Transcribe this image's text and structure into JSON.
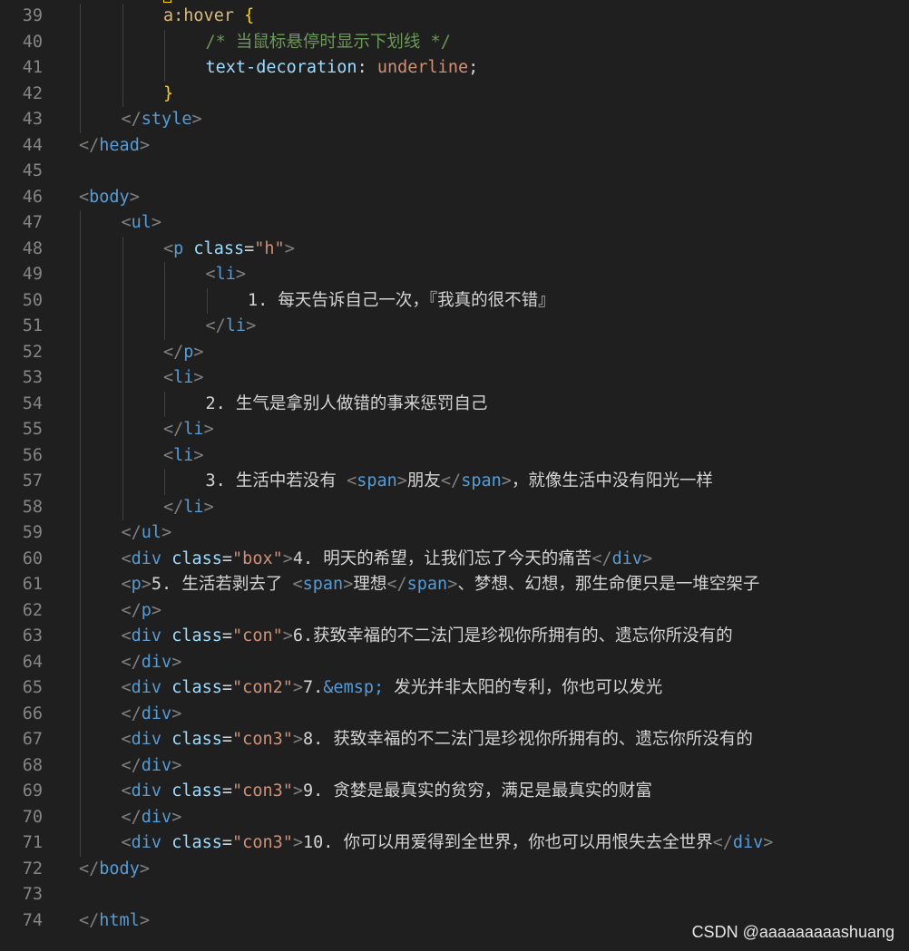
{
  "editor": {
    "lines": [
      {
        "n": "39",
        "indent": 2,
        "tokens": [
          {
            "t": "a:hover ",
            "c": "sel"
          },
          {
            "t": "{",
            "c": "brace"
          }
        ]
      },
      {
        "n": "40",
        "indent": 3,
        "tokens": [
          {
            "t": "/* 当鼠标悬停时显示下划线 */",
            "c": "cmt"
          }
        ]
      },
      {
        "n": "41",
        "indent": 3,
        "tokens": [
          {
            "t": "text-decoration",
            "c": "prop"
          },
          {
            "t": ": ",
            "c": "txt"
          },
          {
            "t": "underline",
            "c": "val"
          },
          {
            "t": ";",
            "c": "txt"
          }
        ]
      },
      {
        "n": "42",
        "indent": 2,
        "tokens": [
          {
            "t": "}",
            "c": "brace"
          }
        ]
      },
      {
        "n": "43",
        "indent": 1,
        "tokens": [
          {
            "t": "</",
            "c": "punc"
          },
          {
            "t": "style",
            "c": "tag"
          },
          {
            "t": ">",
            "c": "punc"
          }
        ]
      },
      {
        "n": "44",
        "indent": 0,
        "tokens": [
          {
            "t": "</",
            "c": "punc"
          },
          {
            "t": "head",
            "c": "tag"
          },
          {
            "t": ">",
            "c": "punc"
          }
        ]
      },
      {
        "n": "45",
        "indent": 0,
        "tokens": []
      },
      {
        "n": "46",
        "indent": 0,
        "tokens": [
          {
            "t": "<",
            "c": "punc"
          },
          {
            "t": "body",
            "c": "tag"
          },
          {
            "t": ">",
            "c": "punc"
          }
        ]
      },
      {
        "n": "47",
        "indent": 1,
        "tokens": [
          {
            "t": "<",
            "c": "punc"
          },
          {
            "t": "ul",
            "c": "tag"
          },
          {
            "t": ">",
            "c": "punc"
          }
        ]
      },
      {
        "n": "48",
        "indent": 2,
        "tokens": [
          {
            "t": "<",
            "c": "punc"
          },
          {
            "t": "p",
            "c": "tag"
          },
          {
            "t": " ",
            "c": "txt"
          },
          {
            "t": "class",
            "c": "attr"
          },
          {
            "t": "=",
            "c": "txt"
          },
          {
            "t": "\"h\"",
            "c": "str"
          },
          {
            "t": ">",
            "c": "punc"
          }
        ]
      },
      {
        "n": "49",
        "indent": 3,
        "tokens": [
          {
            "t": "<",
            "c": "punc"
          },
          {
            "t": "li",
            "c": "tag"
          },
          {
            "t": ">",
            "c": "punc"
          }
        ]
      },
      {
        "n": "50",
        "indent": 4,
        "tokens": [
          {
            "t": "1. 每天告诉自己一次，『我真的很不错』",
            "c": "txt"
          }
        ]
      },
      {
        "n": "51",
        "indent": 3,
        "tokens": [
          {
            "t": "</",
            "c": "punc"
          },
          {
            "t": "li",
            "c": "tag"
          },
          {
            "t": ">",
            "c": "punc"
          }
        ]
      },
      {
        "n": "52",
        "indent": 2,
        "tokens": [
          {
            "t": "</",
            "c": "punc"
          },
          {
            "t": "p",
            "c": "tag"
          },
          {
            "t": ">",
            "c": "punc"
          }
        ]
      },
      {
        "n": "53",
        "indent": 2,
        "tokens": [
          {
            "t": "<",
            "c": "punc"
          },
          {
            "t": "li",
            "c": "tag"
          },
          {
            "t": ">",
            "c": "punc"
          }
        ]
      },
      {
        "n": "54",
        "indent": 3,
        "tokens": [
          {
            "t": "2. 生气是拿别人做错的事来惩罚自己",
            "c": "txt"
          }
        ]
      },
      {
        "n": "55",
        "indent": 2,
        "tokens": [
          {
            "t": "</",
            "c": "punc"
          },
          {
            "t": "li",
            "c": "tag"
          },
          {
            "t": ">",
            "c": "punc"
          }
        ]
      },
      {
        "n": "56",
        "indent": 2,
        "tokens": [
          {
            "t": "<",
            "c": "punc"
          },
          {
            "t": "li",
            "c": "tag"
          },
          {
            "t": ">",
            "c": "punc"
          }
        ]
      },
      {
        "n": "57",
        "indent": 3,
        "tokens": [
          {
            "t": "3. 生活中若没有 ",
            "c": "txt"
          },
          {
            "t": "<",
            "c": "punc"
          },
          {
            "t": "span",
            "c": "tag"
          },
          {
            "t": ">",
            "c": "punc"
          },
          {
            "t": "朋友",
            "c": "txt"
          },
          {
            "t": "</",
            "c": "punc"
          },
          {
            "t": "span",
            "c": "tag"
          },
          {
            "t": ">",
            "c": "punc"
          },
          {
            "t": "，就像生活中没有阳光一样",
            "c": "txt"
          }
        ]
      },
      {
        "n": "58",
        "indent": 2,
        "tokens": [
          {
            "t": "</",
            "c": "punc"
          },
          {
            "t": "li",
            "c": "tag"
          },
          {
            "t": ">",
            "c": "punc"
          }
        ]
      },
      {
        "n": "59",
        "indent": 1,
        "tokens": [
          {
            "t": "</",
            "c": "punc"
          },
          {
            "t": "ul",
            "c": "tag"
          },
          {
            "t": ">",
            "c": "punc"
          }
        ]
      },
      {
        "n": "60",
        "indent": 1,
        "tokens": [
          {
            "t": "<",
            "c": "punc"
          },
          {
            "t": "div",
            "c": "tag"
          },
          {
            "t": " ",
            "c": "txt"
          },
          {
            "t": "class",
            "c": "attr"
          },
          {
            "t": "=",
            "c": "txt"
          },
          {
            "t": "\"box\"",
            "c": "str"
          },
          {
            "t": ">",
            "c": "punc"
          },
          {
            "t": "4. 明天的希望，让我们忘了今天的痛苦",
            "c": "txt"
          },
          {
            "t": "</",
            "c": "punc"
          },
          {
            "t": "div",
            "c": "tag"
          },
          {
            "t": ">",
            "c": "punc"
          }
        ]
      },
      {
        "n": "61",
        "indent": 1,
        "tokens": [
          {
            "t": "<",
            "c": "punc"
          },
          {
            "t": "p",
            "c": "tag"
          },
          {
            "t": ">",
            "c": "punc"
          },
          {
            "t": "5. 生活若剥去了 ",
            "c": "txt"
          },
          {
            "t": "<",
            "c": "punc"
          },
          {
            "t": "span",
            "c": "tag"
          },
          {
            "t": ">",
            "c": "punc"
          },
          {
            "t": "理想",
            "c": "txt"
          },
          {
            "t": "</",
            "c": "punc"
          },
          {
            "t": "span",
            "c": "tag"
          },
          {
            "t": ">",
            "c": "punc"
          },
          {
            "t": "、梦想、幻想，那生命便只是一堆空架子",
            "c": "txt"
          }
        ]
      },
      {
        "n": "62",
        "indent": 1,
        "tokens": [
          {
            "t": "</",
            "c": "punc"
          },
          {
            "t": "p",
            "c": "tag"
          },
          {
            "t": ">",
            "c": "punc"
          }
        ]
      },
      {
        "n": "63",
        "indent": 1,
        "tokens": [
          {
            "t": "<",
            "c": "punc"
          },
          {
            "t": "div",
            "c": "tag"
          },
          {
            "t": " ",
            "c": "txt"
          },
          {
            "t": "class",
            "c": "attr"
          },
          {
            "t": "=",
            "c": "txt"
          },
          {
            "t": "\"con\"",
            "c": "str"
          },
          {
            "t": ">",
            "c": "punc"
          },
          {
            "t": "6.获致幸福的不二法门是珍视你所拥有的、遗忘你所没有的",
            "c": "txt"
          }
        ]
      },
      {
        "n": "64",
        "indent": 1,
        "tokens": [
          {
            "t": "</",
            "c": "punc"
          },
          {
            "t": "div",
            "c": "tag"
          },
          {
            "t": ">",
            "c": "punc"
          }
        ]
      },
      {
        "n": "65",
        "indent": 1,
        "tokens": [
          {
            "t": "<",
            "c": "punc"
          },
          {
            "t": "div",
            "c": "tag"
          },
          {
            "t": " ",
            "c": "txt"
          },
          {
            "t": "class",
            "c": "attr"
          },
          {
            "t": "=",
            "c": "txt"
          },
          {
            "t": "\"con2\"",
            "c": "str"
          },
          {
            "t": ">",
            "c": "punc"
          },
          {
            "t": "7.",
            "c": "txt"
          },
          {
            "t": "&emsp;",
            "c": "ent"
          },
          {
            "t": " 发光并非太阳的专利，你也可以发光",
            "c": "txt"
          }
        ]
      },
      {
        "n": "66",
        "indent": 1,
        "tokens": [
          {
            "t": "</",
            "c": "punc"
          },
          {
            "t": "div",
            "c": "tag"
          },
          {
            "t": ">",
            "c": "punc"
          }
        ]
      },
      {
        "n": "67",
        "indent": 1,
        "tokens": [
          {
            "t": "<",
            "c": "punc"
          },
          {
            "t": "div",
            "c": "tag"
          },
          {
            "t": " ",
            "c": "txt"
          },
          {
            "t": "class",
            "c": "attr"
          },
          {
            "t": "=",
            "c": "txt"
          },
          {
            "t": "\"con3\"",
            "c": "str"
          },
          {
            "t": ">",
            "c": "punc"
          },
          {
            "t": "8. 获致幸福的不二法门是珍视你所拥有的、遗忘你所没有的",
            "c": "txt"
          }
        ]
      },
      {
        "n": "68",
        "indent": 1,
        "tokens": [
          {
            "t": "</",
            "c": "punc"
          },
          {
            "t": "div",
            "c": "tag"
          },
          {
            "t": ">",
            "c": "punc"
          }
        ]
      },
      {
        "n": "69",
        "indent": 1,
        "tokens": [
          {
            "t": "<",
            "c": "punc"
          },
          {
            "t": "div",
            "c": "tag"
          },
          {
            "t": " ",
            "c": "txt"
          },
          {
            "t": "class",
            "c": "attr"
          },
          {
            "t": "=",
            "c": "txt"
          },
          {
            "t": "\"con3\"",
            "c": "str"
          },
          {
            "t": ">",
            "c": "punc"
          },
          {
            "t": "9. 贪婪是最真实的贫穷，满足是最真实的财富",
            "c": "txt"
          }
        ]
      },
      {
        "n": "70",
        "indent": 1,
        "tokens": [
          {
            "t": "</",
            "c": "punc"
          },
          {
            "t": "div",
            "c": "tag"
          },
          {
            "t": ">",
            "c": "punc"
          }
        ]
      },
      {
        "n": "71",
        "indent": 1,
        "tokens": [
          {
            "t": "<",
            "c": "punc"
          },
          {
            "t": "div",
            "c": "tag"
          },
          {
            "t": " ",
            "c": "txt"
          },
          {
            "t": "class",
            "c": "attr"
          },
          {
            "t": "=",
            "c": "txt"
          },
          {
            "t": "\"con3\"",
            "c": "str"
          },
          {
            "t": ">",
            "c": "punc"
          },
          {
            "t": "10. 你可以用爱得到全世界，你也可以用恨失去全世界",
            "c": "txt"
          },
          {
            "t": "</",
            "c": "punc"
          },
          {
            "t": "div",
            "c": "tag"
          },
          {
            "t": ">",
            "c": "punc"
          }
        ]
      },
      {
        "n": "72",
        "indent": 0,
        "tokens": [
          {
            "t": "</",
            "c": "punc"
          },
          {
            "t": "body",
            "c": "tag"
          },
          {
            "t": ">",
            "c": "punc"
          }
        ]
      },
      {
        "n": "73",
        "indent": 0,
        "tokens": []
      },
      {
        "n": "74",
        "indent": 0,
        "tokens": [
          {
            "t": "</",
            "c": "punc"
          },
          {
            "t": "html",
            "c": "tag"
          },
          {
            "t": ">",
            "c": "punc"
          }
        ]
      }
    ]
  },
  "watermark": "CSDN @aaaaaaaaashuang",
  "colors": {
    "background": "#1f1f1f",
    "line_number": "#858585",
    "tag": "#569cd6",
    "attribute": "#9cdcfe",
    "string": "#ce9178",
    "comment": "#6a9955",
    "brace": "#ffd700",
    "selector": "#d7ba7d"
  }
}
